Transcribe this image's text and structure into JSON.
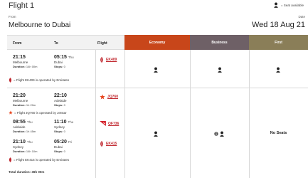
{
  "header": {
    "title": "Flight 1",
    "legend_text": "= Seat available",
    "from_label": "From",
    "route": "Melbourne to Dubai",
    "date_label": "Date",
    "date": "Wed 18 Aug 21"
  },
  "table": {
    "col_from": "From",
    "col_to": "To",
    "col_flight": "Flight",
    "col_economy": "Economy",
    "col_business": "Business",
    "col_first": "First"
  },
  "option1": {
    "depart_time": "21:15",
    "depart_city": "Melbourne",
    "duration_label": "Duration:",
    "duration": "14h 00m",
    "arrive_time": "05:15",
    "arrive_day": "Thu",
    "arrive_city": "Dubai",
    "stops_label": "Stops:",
    "stops": "0",
    "flight_code": "EK409",
    "operated_by": "= Flight EK409 is operated by Emirates"
  },
  "option2": {
    "leg1": {
      "depart_time": "21:20",
      "depart_city": "Melbourne",
      "duration": "1h 20m",
      "arrive_time": "22:10",
      "arrive_city": "Adelaide",
      "stops": "0",
      "flight_code": "JQ760",
      "operated_by": "= Flight JQ760 is operated by Jetstar"
    },
    "leg2": {
      "depart_time": "08:55",
      "depart_day": "Thu",
      "depart_city": "Adelaide",
      "duration": "1h 45m",
      "arrive_time": "11:10",
      "arrive_day": "Thu",
      "arrive_city": "Sydney",
      "stops": "0",
      "flight_code": "QF736"
    },
    "leg3": {
      "depart_time": "21:10",
      "depart_day": "Thu",
      "depart_city": "Sydney",
      "duration": "14h 10m",
      "arrive_time": "05:20",
      "arrive_day": "Fri",
      "arrive_city": "Dubai",
      "stops": "0",
      "flight_code": "EK415",
      "operated_by": "= Flight EK415 is operated by Emirates"
    },
    "total_duration": "Total duration: 36h 00m",
    "first_status": "No Seats"
  },
  "colors": {
    "economy": "#c8461a",
    "business": "#6e6066",
    "first": "#8a7e58",
    "brand_red": "#c0262d"
  }
}
